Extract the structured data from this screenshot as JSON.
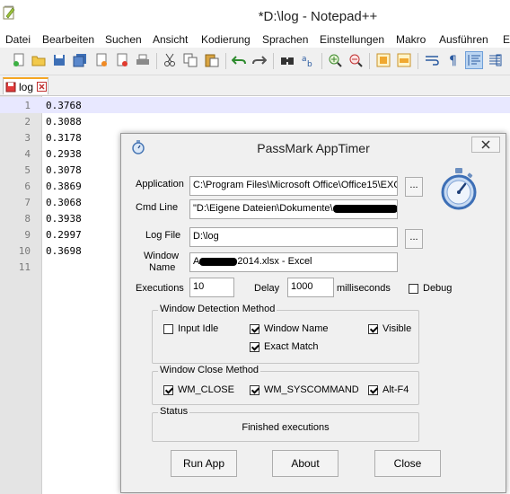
{
  "window": {
    "title": "*D:\\log - Notepad++"
  },
  "menu": [
    {
      "label": "Datei"
    },
    {
      "label": "Bearbeiten"
    },
    {
      "label": "Suchen"
    },
    {
      "label": "Ansicht"
    },
    {
      "label": "Kodierung"
    },
    {
      "label": "Sprachen"
    },
    {
      "label": "Einstellungen"
    },
    {
      "label": "Makro"
    },
    {
      "label": "Ausführen"
    },
    {
      "label": "E"
    }
  ],
  "tab": {
    "label": "log"
  },
  "editor": {
    "lines": [
      {
        "n": "1",
        "text": "0.3768"
      },
      {
        "n": "2",
        "text": "0.3088"
      },
      {
        "n": "3",
        "text": "0.3178"
      },
      {
        "n": "4",
        "text": "0.2938"
      },
      {
        "n": "5",
        "text": "0.3078"
      },
      {
        "n": "6",
        "text": "0.3869"
      },
      {
        "n": "7",
        "text": "0.3068"
      },
      {
        "n": "8",
        "text": "0.3938"
      },
      {
        "n": "9",
        "text": "0.2997"
      },
      {
        "n": "10",
        "text": "0.3698"
      },
      {
        "n": "11",
        "text": ""
      }
    ]
  },
  "dialog": {
    "title": "PassMark AppTimer",
    "application_label": "Application",
    "application_value": "C:\\Program Files\\Microsoft Office\\Office15\\EXC",
    "cmdline_label": "Cmd Line",
    "cmdline_value": "\"D:\\Eigene Dateien\\Dokumente\\",
    "logfile_label": "Log File",
    "logfile_value": "D:\\log",
    "window_label_1": "Window",
    "window_label_2": "Name",
    "window_name_prefix": "A",
    "window_name_mid": "2014",
    "window_name_suffix": ".xlsx - Excel",
    "browse_label": "...",
    "executions_label": "Executions",
    "executions_value": "10",
    "delay_label": "Delay",
    "delay_value": "1000",
    "milliseconds_label": "milliseconds",
    "debug_label": "Debug",
    "detection": {
      "title": "Window Detection Method",
      "input_idle": "Input Idle",
      "window_name": "Window Name",
      "visible": "Visible",
      "exact_match": "Exact Match"
    },
    "close_method": {
      "title": "Window Close Method",
      "wm_close": "WM_CLOSE",
      "wm_syscommand": "WM_SYSCOMMAND",
      "alt_f4": "Alt-F4"
    },
    "status": {
      "title": "Status",
      "text": "Finished executions"
    },
    "buttons": {
      "run_app": "Run App",
      "about": "About",
      "close": "Close"
    }
  }
}
